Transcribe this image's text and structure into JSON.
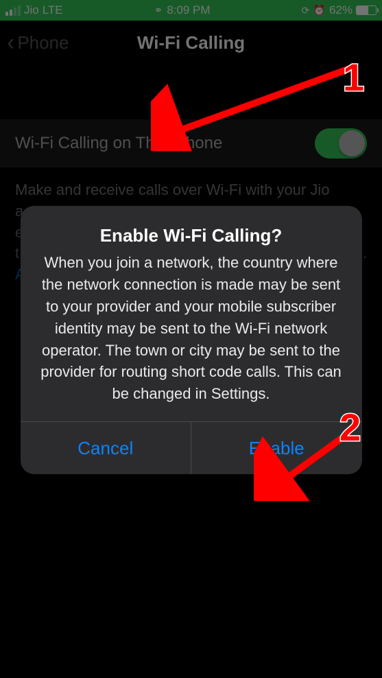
{
  "statusBar": {
    "carrier": "Jio",
    "network": "LTE",
    "time": "8:09 PM",
    "batteryPct": "62%"
  },
  "nav": {
    "back": "Phone",
    "title": "Wi-Fi Calling"
  },
  "row": {
    "label": "Wi-Fi Calling on This iPhone"
  },
  "footer": {
    "line1": "Make and receive calls over Wi-Fi with your Jio",
    "line2a": "a",
    "line2b": "e",
    "line2c": "t",
    "lineEnd": "i.",
    "linkStart": "A"
  },
  "alert": {
    "title": "Enable Wi-Fi Calling?",
    "message": "When you join a network, the country where the network connection is made may be sent to your provider and your mobile subscriber identity may be sent to the Wi-Fi network operator. The town or city may be sent to the provider for routing short code calls. This can be changed in Settings.",
    "cancel": "Cancel",
    "confirm": "Enable"
  },
  "annotations": {
    "num1": "1",
    "num2": "2"
  }
}
